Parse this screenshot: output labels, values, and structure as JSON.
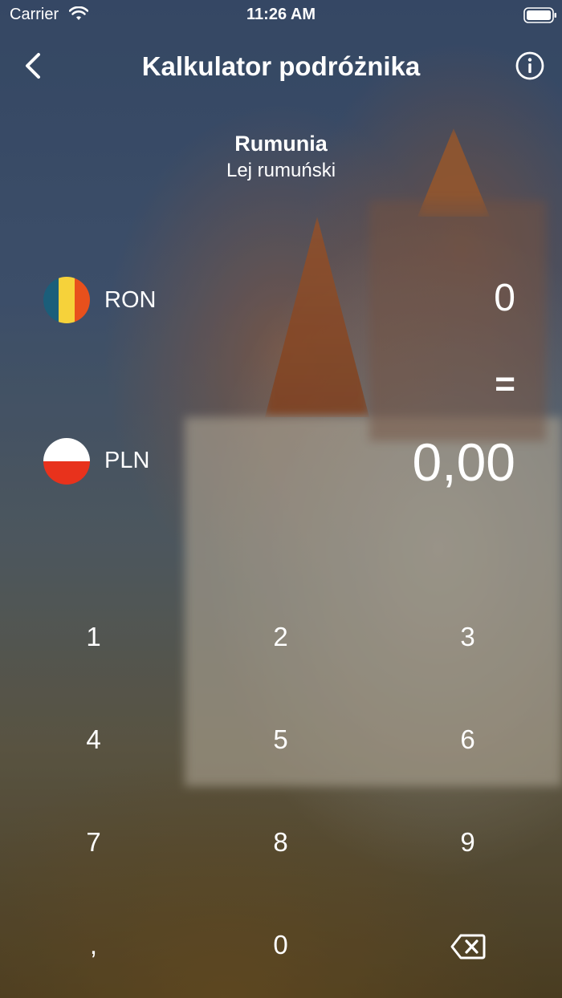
{
  "status_bar": {
    "carrier": "Carrier",
    "time": "11:26 AM"
  },
  "nav": {
    "title": "Kalkulator podróżnika",
    "back_icon": "chevron-left-icon",
    "info_icon": "info-circle-icon"
  },
  "country": {
    "name": "Rumunia",
    "currency_name": "Lej rumuński"
  },
  "from_currency": {
    "code": "RON",
    "amount": "0",
    "flag_colors": [
      "#1b5e7a",
      "#f6d23a",
      "#e8501c"
    ]
  },
  "equals_sign": "=",
  "to_currency": {
    "code": "PLN",
    "amount": "0,00",
    "flag_colors": [
      "#ffffff",
      "#e8321c"
    ]
  },
  "keypad": {
    "keys": [
      "1",
      "2",
      "3",
      "4",
      "5",
      "6",
      "7",
      "8",
      "9",
      ",",
      "0"
    ],
    "delete_icon": "backspace-icon"
  }
}
